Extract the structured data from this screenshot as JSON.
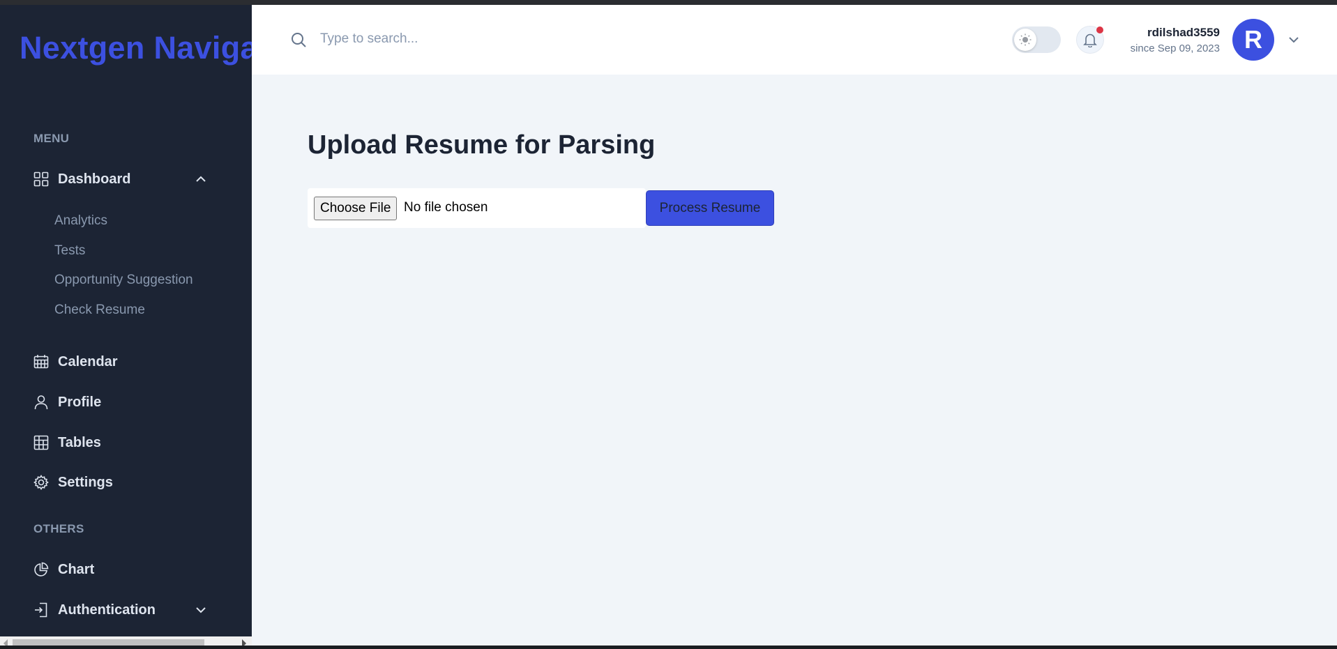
{
  "brand": {
    "title": "Nextgen Naviga"
  },
  "colors": {
    "sidebar_bg": "#1c2434",
    "accent": "#3c50e0",
    "main_bg": "#f1f5f9",
    "notification_dot": "#dc3545"
  },
  "sidebar": {
    "menu_label": "MENU",
    "others_label": "OTHERS",
    "dashboard": {
      "label": "Dashboard",
      "icon": "grid-icon",
      "expanded": true,
      "children": [
        "Analytics",
        "Tests",
        "Opportunity Suggestion",
        "Check Resume"
      ]
    },
    "items": [
      {
        "label": "Calendar",
        "icon": "calendar-icon"
      },
      {
        "label": "Profile",
        "icon": "user-icon"
      },
      {
        "label": "Tables",
        "icon": "table-icon"
      },
      {
        "label": "Settings",
        "icon": "gear-icon"
      }
    ],
    "others": [
      {
        "label": "Chart",
        "icon": "pie-chart-icon"
      },
      {
        "label": "Authentication",
        "icon": "login-icon",
        "expanded": false
      }
    ]
  },
  "header": {
    "search_placeholder": "Type to search...",
    "user": {
      "name": "rdilshad3559",
      "since": "since Sep 09, 2023",
      "initial": "R"
    }
  },
  "main": {
    "title": "Upload Resume for Parsing",
    "file_button": "Choose File",
    "file_status": "No file chosen",
    "submit_button": "Process Resume"
  }
}
